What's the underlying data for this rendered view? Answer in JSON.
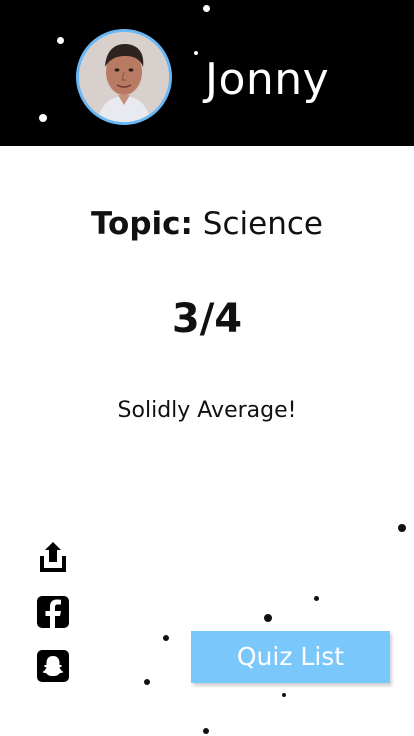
{
  "header": {
    "username": "Jonny",
    "avatar_icon": "user-avatar",
    "avatar_border_color": "#6ab7f5"
  },
  "result": {
    "topic_label": "Topic:",
    "topic_value": "Science",
    "score": "3/4",
    "message": "Solidly Average!"
  },
  "social": {
    "share_icon": "share-icon",
    "facebook_icon": "facebook-icon",
    "snapchat_icon": "snapchat-icon"
  },
  "actions": {
    "quiz_list_label": "Quiz List",
    "button_color": "#7ac7fb"
  }
}
